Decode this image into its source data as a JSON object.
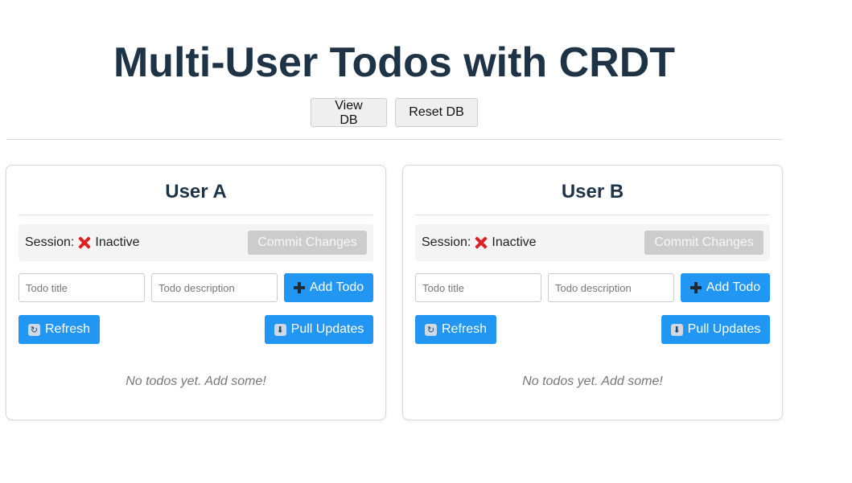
{
  "app": {
    "title": "Multi-User Todos with CRDT"
  },
  "db_controls": {
    "view_label": "View DB",
    "reset_label": "Reset DB"
  },
  "panels": [
    {
      "user": "User A",
      "session_label": "Session:",
      "session_status": "Inactive",
      "session_status_icon": "cross-mark-icon",
      "commit_label": "Commit Changes",
      "title_placeholder": "Todo title",
      "description_placeholder": "Todo description",
      "add_label": "Add Todo",
      "refresh_label": "Refresh",
      "pull_label": "Pull Updates",
      "empty_message": "No todos yet. Add some!"
    },
    {
      "user": "User B",
      "session_label": "Session:",
      "session_status": "Inactive",
      "session_status_icon": "cross-mark-icon",
      "commit_label": "Commit Changes",
      "title_placeholder": "Todo title",
      "description_placeholder": "Todo description",
      "add_label": "Add Todo",
      "refresh_label": "Refresh",
      "pull_label": "Pull Updates",
      "empty_message": "No todos yet. Add some!"
    }
  ],
  "colors": {
    "primary_button": "#2196f3",
    "heading": "#1f3347",
    "inactive_icon": "#e02020",
    "disabled_button": "#cccccc"
  }
}
